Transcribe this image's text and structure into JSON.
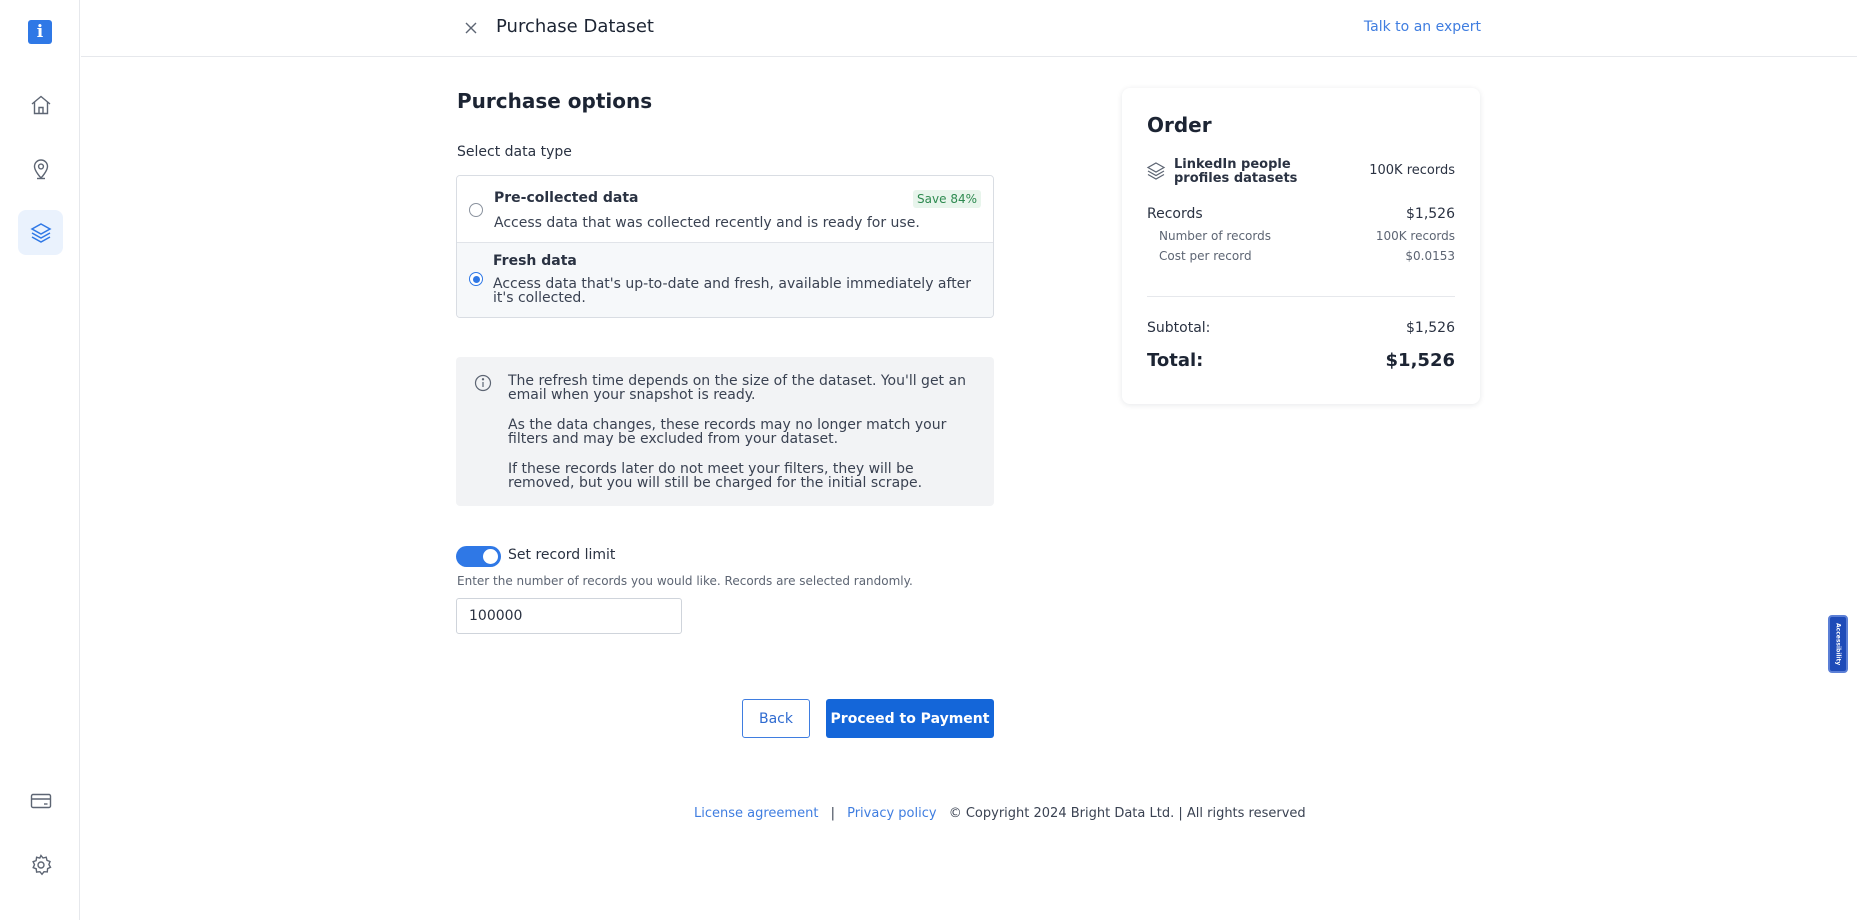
{
  "sidebar": {
    "logo_glyph": "i",
    "items": [
      {
        "name": "home",
        "icon": "home-icon",
        "active": false
      },
      {
        "name": "location",
        "icon": "location-pin-icon",
        "active": false
      },
      {
        "name": "datasets",
        "icon": "layers-icon",
        "active": true
      },
      {
        "name": "billing",
        "icon": "credit-card-icon",
        "active": false
      },
      {
        "name": "settings",
        "icon": "gear-icon",
        "active": false
      }
    ]
  },
  "header": {
    "title": "Purchase Dataset",
    "expert_link": "Talk to an expert"
  },
  "purchase": {
    "section_title": "Purchase options",
    "select_label": "Select data type",
    "options": [
      {
        "title": "Pre-collected data",
        "description": "Access data that was collected recently and is ready for use.",
        "badge": "Save 84%",
        "selected": false
      },
      {
        "title": "Fresh data",
        "description": "Access data that's up-to-date and fresh, available immediately after it's collected.",
        "selected": true
      }
    ],
    "info": [
      "The refresh time depends on the size of the dataset. You'll get an email when your snapshot is ready.",
      "As the data changes, these records may no longer match your filters and may be excluded from your dataset.",
      "If these records later do not meet your filters, they will be removed, but you will still be charged for the initial scrape."
    ],
    "record_limit": {
      "label": "Set record limit",
      "enabled": true,
      "hint": "Enter the number of records you would like. Records are selected randomly.",
      "value": "100000"
    },
    "back_label": "Back",
    "proceed_label": "Proceed to Payment"
  },
  "order": {
    "title": "Order",
    "product_name": "LinkedIn people profiles datasets",
    "product_count": "100K records",
    "records_label": "Records",
    "records_value": "$1,526",
    "number_label": "Number of records",
    "number_value": "100K records",
    "cost_label": "Cost per record",
    "cost_value": "$0.0153",
    "subtotal_label": "Subtotal:",
    "subtotal_value": "$1,526",
    "total_label": "Total:",
    "total_value": "$1,526"
  },
  "footer": {
    "license": "License agreement",
    "separator": "|",
    "privacy": "Privacy policy",
    "copyright": "© Copyright 2024 Bright Data Ltd. | All rights reserved"
  },
  "accessibility_label": "Accessibility",
  "colors": {
    "accent": "#1466d9",
    "link": "#3f7de0",
    "badge_bg": "#e8f5ec",
    "badge_text": "#2e8a50"
  }
}
